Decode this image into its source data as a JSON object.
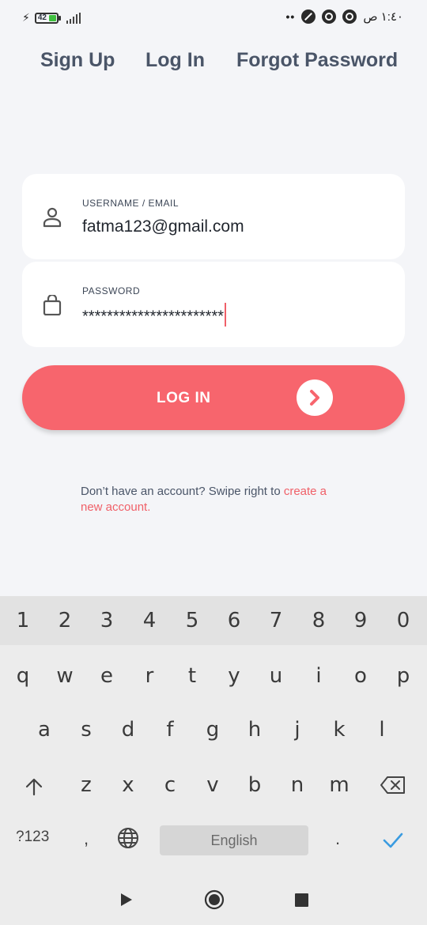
{
  "status_bar": {
    "battery": "42",
    "time": "١:٤٠ ص"
  },
  "tabs": [
    {
      "label": "Sign Up"
    },
    {
      "label": "Log In"
    },
    {
      "label": "Forgot Password"
    }
  ],
  "form": {
    "username": {
      "label": "USERNAME / EMAIL",
      "value": "fatma123@gmail.com"
    },
    "password": {
      "label": "PASSWORD",
      "value": "***********************"
    }
  },
  "login_button": {
    "label": "LOG IN"
  },
  "signup_hint": {
    "text": "Don’t have an account? Swipe right to ",
    "link": "create a new account."
  },
  "keyboard": {
    "numbers": [
      "1",
      "2",
      "3",
      "4",
      "5",
      "6",
      "7",
      "8",
      "9",
      "0"
    ],
    "row1": [
      "q",
      "w",
      "e",
      "r",
      "t",
      "y",
      "u",
      "i",
      "o",
      "p"
    ],
    "row2": [
      "a",
      "s",
      "d",
      "f",
      "g",
      "h",
      "j",
      "k",
      "l"
    ],
    "row3": [
      "z",
      "x",
      "c",
      "v",
      "b",
      "n",
      "m"
    ],
    "symbols_key": "?123",
    "comma_key": ",",
    "period_key": ".",
    "space_label": "English"
  },
  "colors": {
    "accent": "#f7656d",
    "background": "#f4f5f8"
  }
}
